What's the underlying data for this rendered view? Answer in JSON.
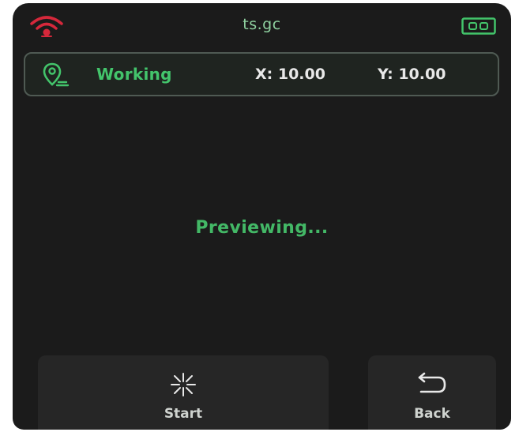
{
  "header": {
    "title": "ts.gc",
    "wifi_icon": "wifi-icon",
    "battery_icon": "battery-icon",
    "wifi_color": "#d6283b",
    "accent_color": "#43c46b"
  },
  "status": {
    "state": "Working",
    "x_label": "X: 10.00",
    "y_label": "Y: 10.00",
    "icon": "location-pin-icon"
  },
  "main": {
    "message": "Previewing..."
  },
  "buttons": {
    "start": {
      "label": "Start",
      "icon": "start-burst-icon"
    },
    "back": {
      "label": "Back",
      "icon": "back-arrow-icon"
    }
  }
}
